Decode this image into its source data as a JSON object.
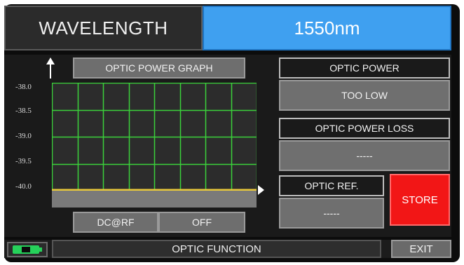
{
  "header": {
    "label": "WAVELENGTH",
    "value": "1550nm"
  },
  "graph": {
    "title": "OPTIC POWER GRAPH",
    "mode_label": "DC@RF",
    "mode_value": "OFF",
    "grid_color": "#3ad13a",
    "trace_color": "#e9c93a"
  },
  "chart_data": {
    "type": "line",
    "title": "OPTIC POWER GRAPH",
    "yticks": [
      "-38.0",
      "-38.5",
      "-39.0",
      "-39.5",
      "-40.0"
    ],
    "ylim": [
      -40.0,
      -38.0
    ],
    "grid": true,
    "series": [
      {
        "values": [
          -40.0,
          -40.0
        ]
      }
    ]
  },
  "readings": {
    "optic_power_label": "OPTIC POWER",
    "optic_power_value": "TOO LOW",
    "optic_power_loss_label": "OPTIC POWER LOSS",
    "optic_power_loss_value": "-----",
    "optic_ref_label": "OPTIC REF.",
    "optic_ref_value": "-----",
    "store_label": "STORE"
  },
  "footer": {
    "title": "OPTIC FUNCTION",
    "exit_label": "EXIT"
  },
  "colors": {
    "accent_blue": "#3fa0f0",
    "store_red": "#f21616",
    "battery_green": "#26d15a"
  }
}
